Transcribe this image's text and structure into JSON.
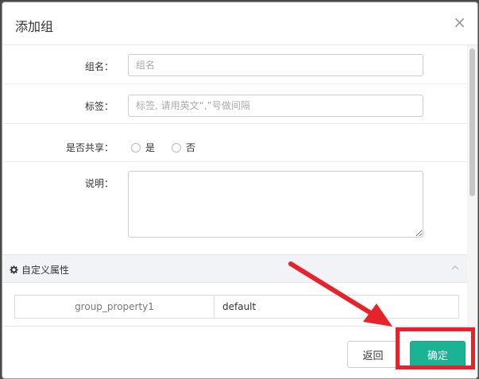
{
  "dialog": {
    "title": "添加组",
    "close_symbol": "×"
  },
  "form": {
    "group_name": {
      "label": "组名：",
      "placeholder": "组名",
      "value": ""
    },
    "tags": {
      "label": "标签：",
      "placeholder": "标签, 请用英文“,”号做间隔",
      "value": ""
    },
    "shared": {
      "label": "是否共享：",
      "options": [
        "是",
        "否"
      ],
      "selected": null
    },
    "description": {
      "label": "说明：",
      "value": ""
    }
  },
  "custom_properties": {
    "title": "自定义属性",
    "rows": [
      {
        "key": "group_property1",
        "value": "default"
      }
    ]
  },
  "footer": {
    "back_label": "返回",
    "ok_label": "确定"
  },
  "colors": {
    "primary": "#1ab394",
    "annotation": "#e8222a"
  }
}
